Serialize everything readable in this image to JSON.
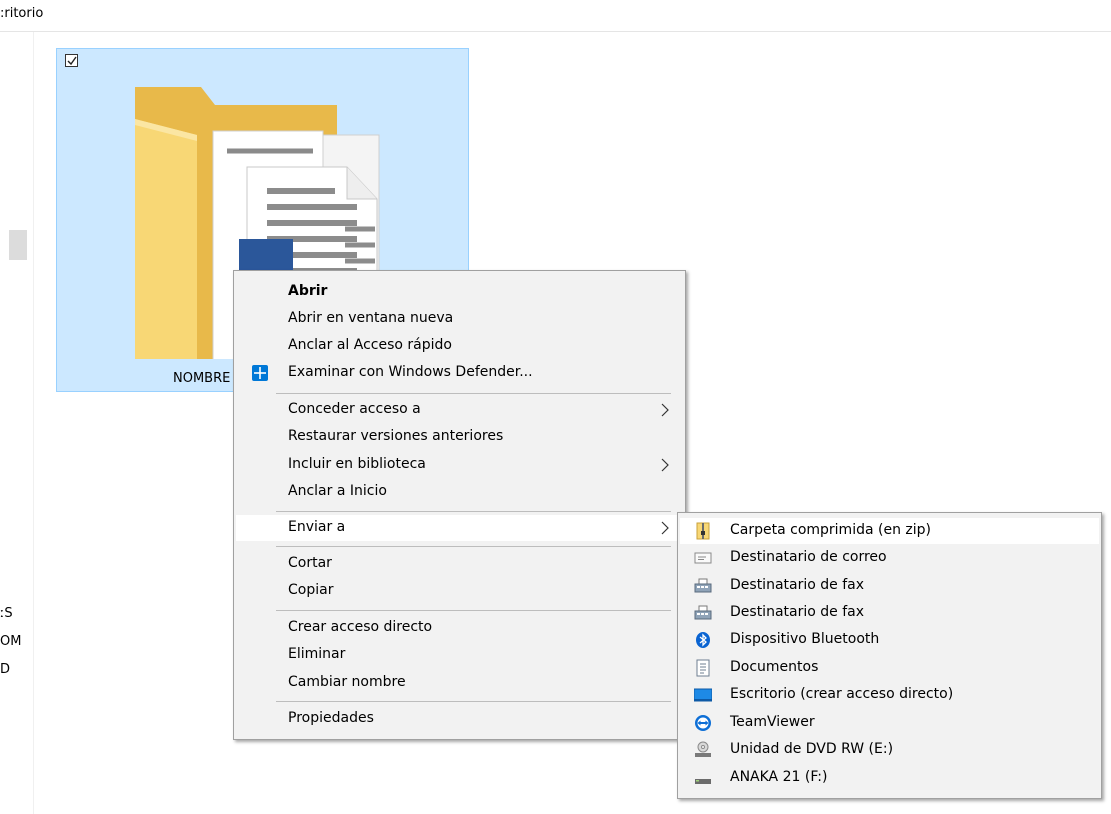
{
  "breadcrumb": {
    "text": ":ritorio"
  },
  "nav_pane": {
    "cut_labels": [
      "ːS",
      "OM",
      "D"
    ]
  },
  "folder": {
    "name": "NOMBRE"
  },
  "context_menu": {
    "items": [
      {
        "label": "Abrir"
      },
      {
        "label": "Abrir en ventana nueva"
      },
      {
        "label": "Anclar al Acceso rápido"
      },
      {
        "label": "Examinar con Windows Defender..."
      },
      {
        "label": "Conceder acceso a"
      },
      {
        "label": "Restaurar versiones anteriores"
      },
      {
        "label": "Incluir en biblioteca"
      },
      {
        "label": "Anclar a Inicio"
      },
      {
        "label": "Enviar a"
      },
      {
        "label": "Cortar"
      },
      {
        "label": "Copiar"
      },
      {
        "label": "Crear acceso directo"
      },
      {
        "label": "Eliminar"
      },
      {
        "label": "Cambiar nombre"
      },
      {
        "label": "Propiedades"
      }
    ]
  },
  "send_to_menu": {
    "items": [
      {
        "label": "Carpeta comprimida (en zip)",
        "icon": "zip-folder-icon"
      },
      {
        "label": "Destinatario de correo",
        "icon": "mail-icon"
      },
      {
        "label": "Destinatario de fax",
        "icon": "fax-icon"
      },
      {
        "label": "Destinatario de fax",
        "icon": "fax-icon"
      },
      {
        "label": "Dispositivo Bluetooth",
        "icon": "bluetooth-icon"
      },
      {
        "label": "Documentos",
        "icon": "documents-icon"
      },
      {
        "label": "Escritorio (crear acceso directo)",
        "icon": "desktop-icon"
      },
      {
        "label": "TeamViewer",
        "icon": "teamviewer-icon"
      },
      {
        "label": "Unidad de DVD RW (E:)",
        "icon": "dvd-drive-icon"
      },
      {
        "label": "ANAKA 21 (F:)",
        "icon": "usb-drive-icon"
      }
    ]
  },
  "colors": {
    "selection_fill": "#cce8ff",
    "selection_border": "#99d1ff",
    "menu_background": "#f2f2f2",
    "menu_hover": "#ffffff",
    "defender_blue": "#0078d7",
    "word_blue": "#2b579a",
    "folder_yellow": "#f8d775"
  }
}
